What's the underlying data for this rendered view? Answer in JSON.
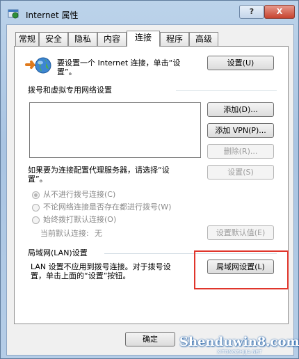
{
  "window": {
    "title": "Internet 属性",
    "help_label": "?",
    "close_label": "X"
  },
  "tabs": [
    {
      "label": "常规"
    },
    {
      "label": "安全"
    },
    {
      "label": "隐私"
    },
    {
      "label": "内容"
    },
    {
      "label": "连接",
      "active": true
    },
    {
      "label": "程序"
    },
    {
      "label": "高级"
    }
  ],
  "setup": {
    "text": "要设置一个 Internet 连接，单击“设置”。",
    "line1": "要设置一个 Internet 连接，单击“设",
    "line2": "置”。",
    "button": "设置(U)"
  },
  "dialup": {
    "heading": "拨号和虚拟专用网络设置",
    "add_button": "添加(D)...",
    "add_vpn_button": "添加 VPN(P)...",
    "remove_button": "删除(R)...",
    "proxy_text_line1": "如果要为连接配置代理服务器，请选择“设",
    "proxy_text_line2": "置”。",
    "settings_button": "设置(S)",
    "options": [
      {
        "label": "从不进行拨号连接(C)",
        "checked": true
      },
      {
        "label": "不论网络连接是否存在都进行拨号(W)",
        "checked": false
      },
      {
        "label": "始终拨打默认连接(O)",
        "checked": false
      }
    ],
    "default_label": "当前默认连接:",
    "default_value": "无",
    "set_default_button": "设置默认值(E)"
  },
  "lan": {
    "heading": "局域网(LAN)设置",
    "text_line1": "LAN 设置不应用到拨号连接。对于拨号设",
    "text_line2": "置，单击上面的“设置”按钮。",
    "button": "局域网设置(L)"
  },
  "footer": {
    "ok_button": "确定"
  },
  "watermark": {
    "main": "Shenduwin8.com",
    "sub": "XITONGZHIJIA.NET"
  },
  "colors": {
    "highlight": "#e0352b",
    "title_bar": "#a9c4e2"
  }
}
